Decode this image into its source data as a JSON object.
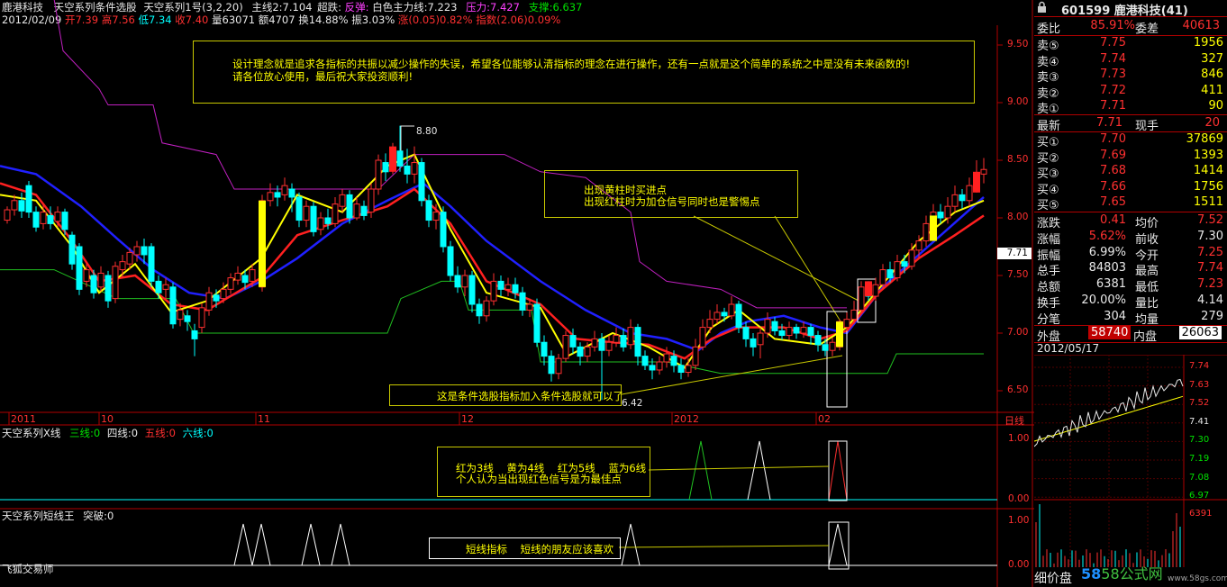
{
  "header": {
    "stock_name": "鹿港科技",
    "indicator_title": "天空系列条件选股",
    "params": "天空系列1号(3,2,20)",
    "main_line": "主线2:7.104",
    "super_label": "超跌:",
    "rebound": "反弹:",
    "white_main": "白色主力线:7.223",
    "pressure": "压力:7.427",
    "support": "支撑:6.637"
  },
  "quote_line": {
    "date": "2012/02/09",
    "open": "开7.39",
    "high": "高7.56",
    "low": "低7.34",
    "close": "收7.40",
    "volume": "量63071",
    "amount": "额4707",
    "turnover": "换14.88%",
    "amplitude": "振3.03%",
    "change": "涨(0.05)0.82%",
    "index": "指数(2.06)0.09%"
  },
  "annotations": {
    "design_note_1": "设计理念就是追求各指标的共振以减少操作的失误，希望各位能够认清指标的理念在进行操作，还有一点就是这个简单的系统之中是没有未来函数的!",
    "design_note_2": "请各位放心使用，最后祝大家投资顺利!",
    "signal_note_1": "出现黄柱时买进点",
    "signal_note_2": "出现红柱时为加仓信号同时也是警惕点",
    "condition_note": "这是条件选股指标加入条件选股就可以了",
    "lines_note_1": "红为3线    黄为4线    红为5线    蓝为6线",
    "lines_note_2": "个人认为当出现红色信号是为最佳点",
    "short_note": "短线指标    短线的朋友应该喜欢",
    "high_mark": "8.80",
    "low_mark": "6.42"
  },
  "price_axis": [
    "9.50",
    "9.00",
    "8.50",
    "8.00",
    "7.50",
    "7.00",
    "6.50"
  ],
  "current_price_tag": "7.71",
  "time_axis": [
    "2011",
    "10",
    "11",
    "12",
    "2012",
    "02"
  ],
  "period_label": "日线",
  "sub1": {
    "title": "天空系列X线",
    "l3": "三线:0",
    "l4": "四线:0",
    "l5": "五线:0",
    "l6": "六线:0",
    "ticks": [
      "1.00",
      "0.00"
    ]
  },
  "sub2": {
    "title": "天空系列短线王",
    "breakout": "突破:0",
    "ticks": [
      "1.00",
      "0.00"
    ],
    "watermark": "飞狐交易师"
  },
  "right_panel": {
    "code_name": "601599 鹿港科技(41)",
    "weibi_label": "委比",
    "weibi_value": "85.91%",
    "weicha_label": "委差",
    "weicha_value": "40613",
    "sell": [
      {
        "label": "卖⑤",
        "price": "7.75",
        "vol": "1956"
      },
      {
        "label": "卖④",
        "price": "7.74",
        "vol": "327"
      },
      {
        "label": "卖③",
        "price": "7.73",
        "vol": "846"
      },
      {
        "label": "卖②",
        "price": "7.72",
        "vol": "411"
      },
      {
        "label": "卖①",
        "price": "7.71",
        "vol": "90"
      }
    ],
    "latest_label": "最新",
    "latest_value": "7.71",
    "xianshou_label": "现手",
    "xianshou_value": "20",
    "buy": [
      {
        "label": "买①",
        "price": "7.70",
        "vol": "37869"
      },
      {
        "label": "买②",
        "price": "7.69",
        "vol": "1393"
      },
      {
        "label": "买③",
        "price": "7.68",
        "vol": "1414"
      },
      {
        "label": "买④",
        "price": "7.66",
        "vol": "1756"
      },
      {
        "label": "买⑤",
        "price": "7.65",
        "vol": "1511"
      }
    ],
    "stats": [
      {
        "l1": "涨跌",
        "v1": "0.41",
        "l2": "均价",
        "v2": "7.52"
      },
      {
        "l1": "涨幅",
        "v1": "5.62%",
        "l2": "前收",
        "v2": "7.30"
      },
      {
        "l1": "振幅",
        "v1": "6.99%",
        "l2": "今开",
        "v2": "7.25"
      },
      {
        "l1": "总手",
        "v1": "84803",
        "l2": "最高",
        "v2": "7.74"
      },
      {
        "l1": "总额",
        "v1": "6381",
        "l2": "最低",
        "v2": "7.23"
      },
      {
        "l1": "换手",
        "v1": "20.00%",
        "l2": "量比",
        "v2": "4.14"
      },
      {
        "l1": "分笔",
        "v1": "304",
        "l2": "均量",
        "v2": "279"
      }
    ],
    "outer_label": "外盘",
    "outer_value": "58740",
    "inner_label": "内盘",
    "inner_value": "26063",
    "mini_date": "2012/05/17",
    "mini_ticks": [
      "7.74",
      "7.63",
      "7.52",
      "7.41",
      "7.30",
      "7.19",
      "7.08",
      "6.97",
      "6391"
    ],
    "detail_label": "细价盘",
    "site_watermark": "58公式网",
    "site_url": "www.58gs.com"
  },
  "colors": {
    "up": "#ff3030",
    "down": "#00ffff",
    "ma_yellow": "#ffff00",
    "ma_red": "#ff2020",
    "ma_blue": "#2020ff",
    "upper_band": "#c020c0",
    "lower_band": "#20c020",
    "signal_yellow": "#ffff00"
  }
}
